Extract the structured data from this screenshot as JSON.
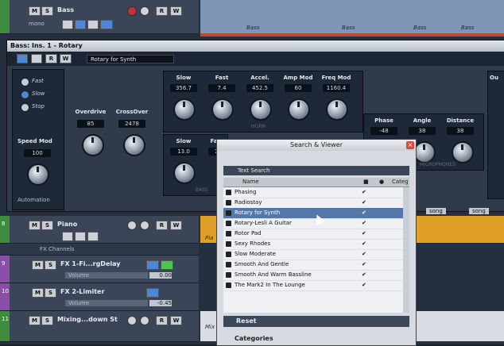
{
  "tracks": {
    "bass": {
      "mute": "M",
      "solo": "S",
      "name": "Bass",
      "sub": "mono",
      "read": "R",
      "write": "W",
      "part": "Bass"
    },
    "piano": {
      "num": "8",
      "mute": "M",
      "solo": "S",
      "name": "Piano",
      "read": "R",
      "write": "W",
      "part": "Pia"
    },
    "fx_folder": {
      "name": "FX Channels"
    },
    "fx1": {
      "num": "9",
      "mute": "M",
      "solo": "S",
      "name": "FX 1-Fi...rgDelay",
      "param": "Volume",
      "value": "0.00"
    },
    "fx2": {
      "num": "10",
      "mute": "M",
      "solo": "S",
      "name": "FX 2-Limiter",
      "param": "Volume",
      "value": "-0.45"
    },
    "mix": {
      "num": "11",
      "mute": "M",
      "solo": "S",
      "name": "Mixing...down St",
      "read": "R",
      "write": "W",
      "part": "Mix"
    },
    "lane_labels": [
      "Bass",
      "Bass",
      "Bass",
      "Bass"
    ],
    "song_labels": [
      "song",
      "song"
    ]
  },
  "plugin": {
    "title": "Bass: Ins. 1 - Rotary",
    "read": "R",
    "write": "W",
    "preset": "Rotary for Synth",
    "speed_modes": [
      "Fast",
      "Slow",
      "Stop"
    ],
    "speed_mod_label": "Speed Mod",
    "speed_mod_value": "100",
    "automation_label": "Automation",
    "overdrive": {
      "label": "Overdrive",
      "value": "85"
    },
    "crossover": {
      "label": "CrossOver",
      "value": "2478"
    },
    "horn_knobs": [
      {
        "label": "Slow",
        "value": "356.7"
      },
      {
        "label": "Fast",
        "value": "7.4"
      },
      {
        "label": "Accel.",
        "value": "452.5"
      },
      {
        "label": "Amp Mod",
        "value": "60"
      },
      {
        "label": "Freq Mod",
        "value": "1160.4"
      }
    ],
    "horn_section": "HORN",
    "bass_knobs": [
      {
        "label": "Slow",
        "value": "13.0"
      },
      {
        "label": "Fa",
        "value": "7"
      }
    ],
    "bass_section": "BASS",
    "mic_knobs": [
      {
        "label": "Phase",
        "value": "-48"
      },
      {
        "label": "Angle",
        "value": "38"
      },
      {
        "label": "Distance",
        "value": "38"
      }
    ],
    "mic_section": "MICROPHONES",
    "out_label": "Ou"
  },
  "viewer": {
    "title": "Search & Viewer",
    "close": "×",
    "search_text": "Text Search",
    "header": {
      "name": "Name",
      "cate": "Categ"
    },
    "presets": [
      {
        "name": "Phasing",
        "check": "✔"
      },
      {
        "name": "Radiostay",
        "check": "✔"
      },
      {
        "name": "Rotary for Synth",
        "check": "✔"
      },
      {
        "name": "Rotary-Lesli A Guitar",
        "check": "✔"
      },
      {
        "name": "Rotor Pad",
        "check": "✔"
      },
      {
        "name": "Sexy Rhodes",
        "check": "✔"
      },
      {
        "name": "Slow Moderate",
        "check": "✔"
      },
      {
        "name": "Smooth And Gentle",
        "check": "✔"
      },
      {
        "name": "Smooth And Warm Bassline",
        "check": "✔"
      },
      {
        "name": "The Mark2 In The Lounge",
        "check": "✔"
      }
    ],
    "selected_index": 2,
    "reset": "Reset",
    "categories": "Categories"
  }
}
